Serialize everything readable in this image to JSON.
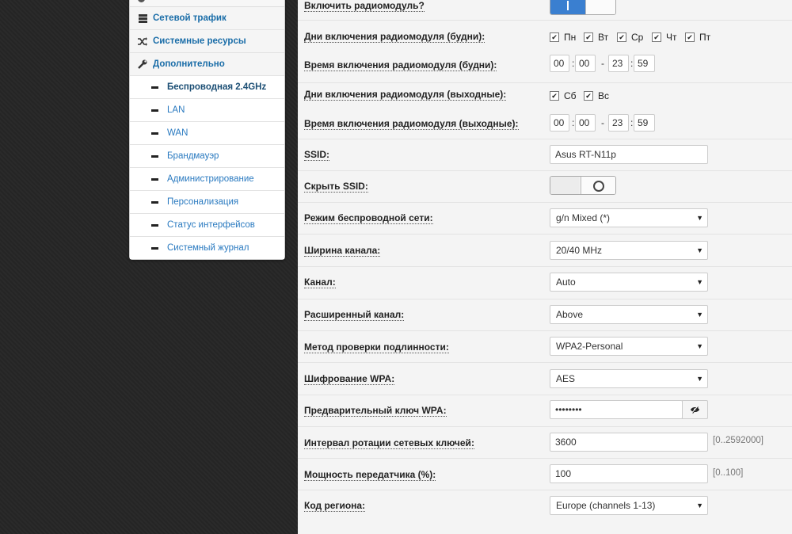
{
  "sidebar": {
    "items": [
      {
        "label": "Сетевой трафик",
        "icon": "database-icon"
      },
      {
        "label": "Системные ресурсы",
        "icon": "shuffle-icon"
      },
      {
        "label": "Дополнительно",
        "icon": "wrench-icon"
      }
    ],
    "subitems": [
      {
        "label": "Беспроводная 2.4GHz",
        "active": true
      },
      {
        "label": "LAN"
      },
      {
        "label": "WAN"
      },
      {
        "label": "Брандмауэр"
      },
      {
        "label": "Администрирование"
      },
      {
        "label": "Персонализация"
      },
      {
        "label": "Статус интерфейсов"
      },
      {
        "label": "Системный журнал"
      }
    ]
  },
  "form": {
    "radio_enable": {
      "label": "Включить радиомодуль?",
      "value": true
    },
    "weekday_days": {
      "label": "Дни включения радиомодуля (будни):",
      "days": [
        {
          "label": "Пн",
          "checked": true
        },
        {
          "label": "Вт",
          "checked": true
        },
        {
          "label": "Ср",
          "checked": true
        },
        {
          "label": "Чт",
          "checked": true
        },
        {
          "label": "Пт",
          "checked": true
        }
      ]
    },
    "weekday_time": {
      "label": "Время включения радиомодуля (будни):",
      "start_h": "00",
      "start_m": "00",
      "end_h": "23",
      "end_m": "59",
      "sep_colon": ":",
      "sep_dash": "-"
    },
    "weekend_days": {
      "label": "Дни включения радиомодуля (выходные):",
      "days": [
        {
          "label": "Сб",
          "checked": true
        },
        {
          "label": "Вс",
          "checked": true
        }
      ]
    },
    "weekend_time": {
      "label": "Время включения радиомодуля (выходные):",
      "start_h": "00",
      "start_m": "00",
      "end_h": "23",
      "end_m": "59"
    },
    "ssid": {
      "label": "SSID:",
      "value": "Asus RT-N11p"
    },
    "hide_ssid": {
      "label": "Скрыть SSID:",
      "value": false
    },
    "wireless_mode": {
      "label": "Режим беспроводной сети:",
      "value": "g/n Mixed (*)"
    },
    "channel_width": {
      "label": "Ширина канала:",
      "value": "20/40 MHz"
    },
    "channel": {
      "label": "Канал:",
      "value": "Auto"
    },
    "ext_channel": {
      "label": "Расширенный канал:",
      "value": "Above"
    },
    "auth_method": {
      "label": "Метод проверки подлинности:",
      "value": "WPA2-Personal"
    },
    "wpa_encryption": {
      "label": "Шифрование WPA:",
      "value": "AES"
    },
    "wpa_key": {
      "label": "Предварительный ключ WPA:",
      "value": "••••••••"
    },
    "rekey_interval": {
      "label": "Интервал ротации сетевых ключей:",
      "value": "3600",
      "hint": "[0..2592000]"
    },
    "tx_power": {
      "label": "Мощность передатчика (%):",
      "value": "100",
      "hint": "[0..100]"
    },
    "region": {
      "label": "Код региона:",
      "value": "Europe (channels 1-13)"
    }
  },
  "icons": {
    "check": "✔",
    "arrow": "▼",
    "eye": "eye-slash-icon"
  }
}
